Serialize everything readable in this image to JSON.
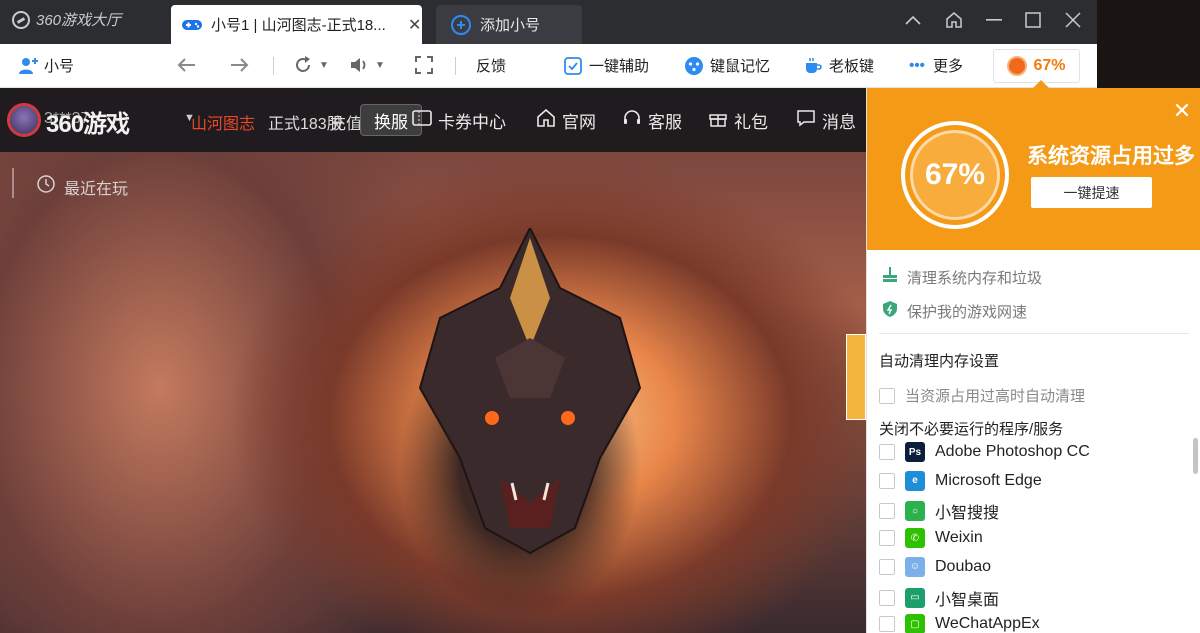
{
  "titlebar": {
    "brand": "360游戏大厅",
    "active_tab_title": "小号1 | 山河图志-正式18...",
    "add_tab_label": "添加小号",
    "window_controls": [
      "collapse-icon",
      "home-icon",
      "minimize-icon",
      "maximize-icon",
      "close-icon"
    ]
  },
  "toolbar": {
    "account_label": "小号",
    "feedback_label": "反馈",
    "assist_label": "一键辅助",
    "macro_label": "键鼠记忆",
    "boss_key_label": "老板键",
    "more_label": "更多",
    "usage_label": "67%"
  },
  "game": {
    "logo": "360游戏",
    "account": "3***37",
    "server_game": "山河图志",
    "server_name": "正式183服",
    "recharge_label": "充值",
    "switch_label": "换服",
    "coupon_label": "卡券中心",
    "site_label": "官网",
    "service_label": "客服",
    "gift_label": "礼包",
    "message_label": "消息",
    "recent_label": "最近在玩"
  },
  "panel": {
    "gauge_value": "67%",
    "title": "系统资源占用过多",
    "speed_button": "一键提速",
    "clean_link": "清理系统内存和垃圾",
    "protect_link": "保护我的游戏网速",
    "auto_heading": "自动清理内存设置",
    "auto_option": "当资源占用过高时自动清理",
    "close_heading": "关闭不必要运行的程序/服务",
    "apps": [
      {
        "name": "Adobe Photoshop CC",
        "icon": "photoshop-icon",
        "color": "#0b1f3a"
      },
      {
        "name": "Microsoft Edge",
        "icon": "edge-icon",
        "color": "#1e8fd6"
      },
      {
        "name": "小智搜搜",
        "icon": "search-icon",
        "color": "#2bb24c"
      },
      {
        "name": "Weixin",
        "icon": "weixin-icon",
        "color": "#2dc100"
      },
      {
        "name": "Doubao",
        "icon": "doubao-icon",
        "color": "#7ab1e8"
      },
      {
        "name": "小智桌面",
        "icon": "desktop-icon",
        "color": "#1c9f6a"
      },
      {
        "name": "WeChatAppEx",
        "icon": "wechat-app-icon",
        "color": "#2dc100"
      }
    ]
  },
  "colors": {
    "accent_orange": "#f59a16",
    "titlebar": "#2b2d31",
    "server_red": "#e9482a"
  }
}
